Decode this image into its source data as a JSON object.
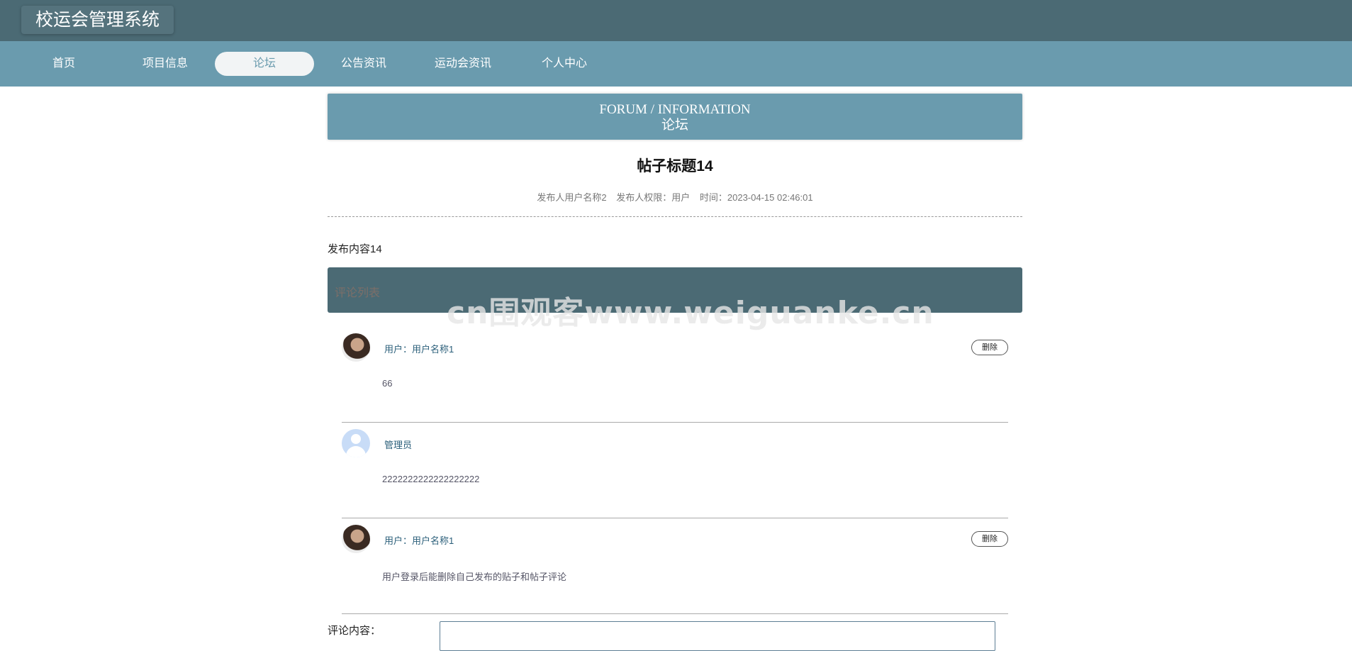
{
  "app": {
    "title": "校运会管理系统"
  },
  "nav": {
    "items": [
      {
        "label": "首页"
      },
      {
        "label": "项目信息"
      },
      {
        "label": "论坛"
      },
      {
        "label": "公告资讯"
      },
      {
        "label": "运动会资讯"
      },
      {
        "label": "个人中心"
      }
    ],
    "active_index": 2
  },
  "section": {
    "title_en": "FORUM / INFORMATION",
    "title_cn": "论坛"
  },
  "post": {
    "title": "帖子标题14",
    "author": "发布人用户名称2",
    "role": "发布人权限：用户",
    "time": "时间：2023-04-15 02:46:01",
    "content": "发布内容14"
  },
  "comments_section": {
    "label": "评论列表"
  },
  "watermark": "cn围观客www.weiguanke.cn",
  "comments": [
    {
      "name": "用户：用户名称1",
      "text": "66",
      "avatar": "user-photo",
      "delete_label": "删除"
    },
    {
      "name": "管理员",
      "text": "2222222222222222222",
      "avatar": "default-avatar",
      "delete_label": ""
    },
    {
      "name": "用户：用户名称1",
      "text": "用户登录后能删除自己发布的贴子和帖子评论",
      "avatar": "user-photo",
      "delete_label": "删除"
    }
  ],
  "comment_form": {
    "label": "评论内容：",
    "value": ""
  },
  "colors": {
    "topbar": "#4b6a74",
    "navbar": "#6a9bae",
    "accent": "#2b5f7a"
  }
}
